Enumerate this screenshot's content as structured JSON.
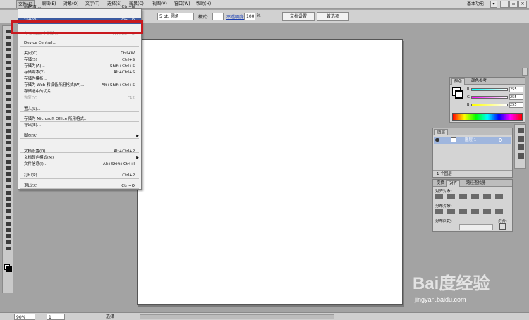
{
  "menubar": {
    "items": [
      "文件(F)",
      "编辑(E)",
      "对象(O)",
      "文字(T)",
      "选择(S)",
      "效果(C)",
      "视图(V)",
      "窗口(W)",
      "帮助(H)"
    ],
    "workspace": "基本功能"
  },
  "control_bar": {
    "stroke_profile": "5 pt. 圆角",
    "style_label": "样式:",
    "opacity_label": "不透明度:",
    "opacity_value": "100",
    "opacity_unit": "%",
    "doc_setup_button": "文档设置",
    "preferences_button": "首选项"
  },
  "file_menu": {
    "items": [
      {
        "label": "新建(N)...",
        "shortcut": "Ctrl+N"
      },
      {
        "label": "打开(O)...",
        "shortcut": "Ctrl+O",
        "highlighted": true
      },
      {
        "label": "在 Bridge 中浏览...",
        "shortcut": "Alt+Ctrl+O",
        "disabled": true
      },
      {
        "label": "Device Central..."
      },
      {
        "label": "关闭(C)",
        "shortcut": "Ctrl+W"
      },
      {
        "label": "存储(S)",
        "shortcut": "Ctrl+S"
      },
      {
        "label": "存储为(A)...",
        "shortcut": "Shift+Ctrl+S"
      },
      {
        "label": "存储副本(Y)...",
        "shortcut": "Alt+Ctrl+S"
      },
      {
        "label": "存储为模板..."
      },
      {
        "label": "存储为 Web 和设备所用格式(W)...",
        "shortcut": "Alt+Shift+Ctrl+S"
      },
      {
        "label": "存储选中的切片..."
      },
      {
        "label": "恢复(V)",
        "shortcut": "F12",
        "disabled": true
      },
      {
        "label": "置入(L)..."
      },
      {
        "label": "存储为 Microsoft Office 所用格式..."
      },
      {
        "label": "导出(E)..."
      },
      {
        "label": "脚本(R)",
        "submenu": true
      },
      {
        "label": "文档设置(D)...",
        "shortcut": "Alt+Ctrl+P"
      },
      {
        "label": "文档颜色模式(M)",
        "submenu": true
      },
      {
        "label": "文件信息(I)...",
        "shortcut": "Alt+Shift+Ctrl+I"
      },
      {
        "label": "打印(P)...",
        "shortcut": "Ctrl+P"
      },
      {
        "label": "退出(X)",
        "shortcut": "Ctrl+Q"
      }
    ]
  },
  "color_panel": {
    "tabs": [
      "颜色",
      "颜色参考"
    ],
    "channels": [
      {
        "name": "R",
        "value": "255",
        "color": "#d23a2a"
      },
      {
        "name": "G",
        "value": "255",
        "color": "#3aa33a"
      },
      {
        "name": "B",
        "value": "255",
        "color": "#3a4bd2"
      }
    ]
  },
  "layers_panel": {
    "tab": "图层",
    "layer_name": "图层 1",
    "footer": "1 个图层"
  },
  "transform_panel": {
    "tabs": [
      "变换",
      "对齐",
      "路径查找器"
    ],
    "align_objects": "对齐对象:",
    "distribute_objects": "分布对象:",
    "distribute_spacing": "分布间距:",
    "align_to": "对齐:"
  },
  "status_bar": {
    "zoom": "90%",
    "artboard": "1",
    "tool": "选择"
  },
  "watermark": {
    "brand": "Bai度经验",
    "url": "jingyan.baidu.com"
  }
}
